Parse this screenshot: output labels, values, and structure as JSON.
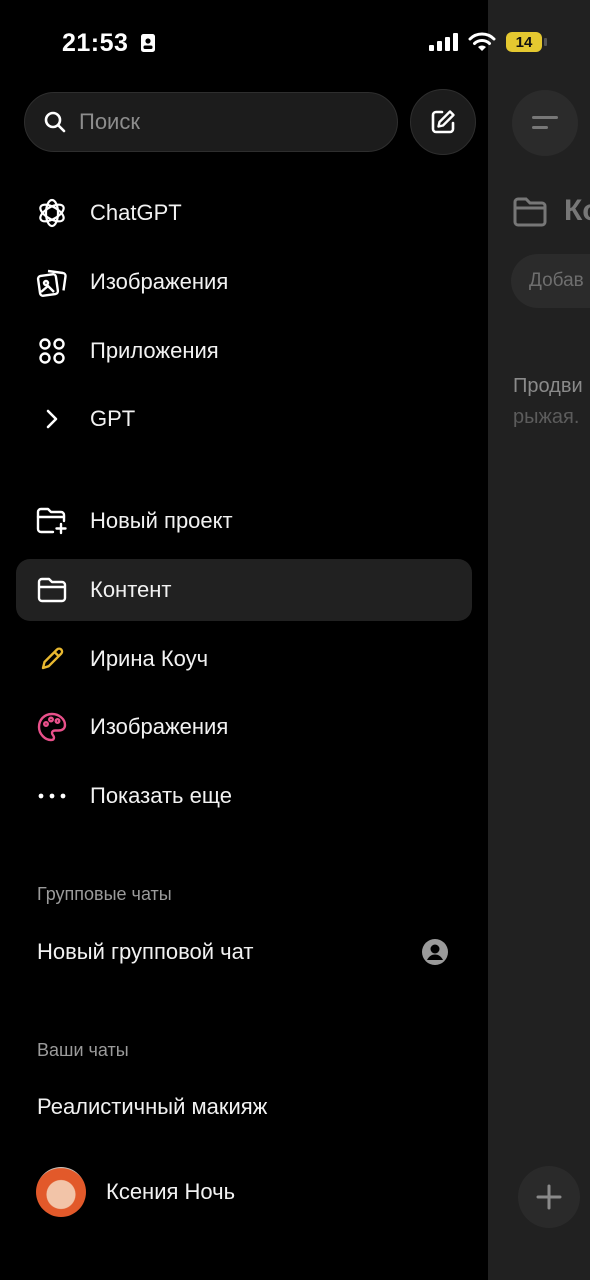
{
  "status_bar": {
    "time": "21:53",
    "battery": "14"
  },
  "search": {
    "placeholder": "Поиск"
  },
  "nav": {
    "items": [
      {
        "label": "ChatGPT",
        "icon": "openai-logo-icon"
      },
      {
        "label": "Изображения",
        "icon": "images-icon"
      },
      {
        "label": "Приложения",
        "icon": "apps-grid-icon"
      },
      {
        "label": "GPT",
        "icon": "chevron-right-icon"
      }
    ]
  },
  "projects": {
    "items": [
      {
        "label": "Новый проект",
        "icon": "folder-plus-icon"
      },
      {
        "label": "Контент",
        "icon": "folder-icon",
        "active": true
      },
      {
        "label": "Ирина Коуч",
        "icon": "pencil-icon",
        "color": "#e8b830"
      },
      {
        "label": "Изображения",
        "icon": "palette-icon",
        "color": "#e8508a"
      },
      {
        "label": "Показать еще",
        "icon": "more-dots-icon"
      }
    ]
  },
  "group_chats": {
    "title": "Групповые чаты",
    "items": [
      {
        "label": "Новый групповой чат"
      }
    ]
  },
  "your_chats": {
    "title": "Ваши чаты",
    "items": [
      {
        "label": "Реалистичный макияж"
      }
    ]
  },
  "user": {
    "name": "Ксения Ночь"
  },
  "background_page": {
    "title": "Ко",
    "chip": "Добав",
    "line1": "Продви",
    "line2": "рыжая."
  }
}
